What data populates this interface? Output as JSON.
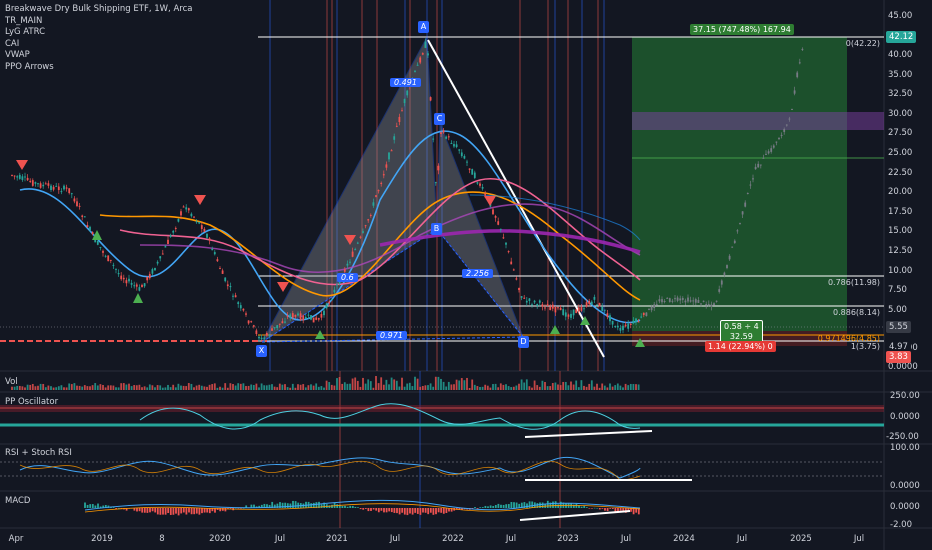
{
  "legend": {
    "title": "Breakwave Dry Bulk Shipping ETF, 1W, Arca",
    "indicators": [
      "TR_MAIN",
      "LyG ATRC",
      "CAI",
      "VWAP",
      "PPO Arrows"
    ]
  },
  "panes": {
    "vol": "Vol",
    "ppo": "PP Oscillator",
    "rsi": "RSI + Stoch RSI",
    "macd": "MACD"
  },
  "price_axis": [
    "45.00",
    "40.00",
    "35.00",
    "32.50",
    "30.00",
    "27.50",
    "25.00",
    "22.50",
    "20.00",
    "17.50",
    "15.00",
    "12.50",
    "10.00",
    "7.50",
    "5.00",
    "2.50",
    "0.0000"
  ],
  "price_labels": {
    "last_high": "42.12",
    "current": "5.55",
    "low_green": "4.97",
    "low_red": "3.83"
  },
  "ppo_axis": [
    "250.00",
    "0.0000",
    "-250.00"
  ],
  "rsi_axis": [
    "100.00",
    "0.0000"
  ],
  "macd_axis": [
    "0.0000",
    "-2.00"
  ],
  "time_axis": [
    "Apr",
    "2019",
    "8",
    "2020",
    "Jul",
    "2021",
    "Jul",
    "2022",
    "Jul",
    "2023",
    "Jul",
    "2024",
    "Jul",
    "2025",
    "Jul"
  ],
  "pattern": {
    "points": [
      "X",
      "A",
      "B",
      "C",
      "D"
    ],
    "ratios": [
      "0.491",
      "0.6",
      "2.256",
      "0.971"
    ]
  },
  "fib_levels": [
    "0(42.22)",
    "0.786(11.98)",
    "0.886(8.14)",
    "0.971496(4.85)",
    "1(3.75)"
  ],
  "trade_box": {
    "top_label": "37.15 (747.48%) 167.94",
    "middle_label_1": "0.58 ÷ 4",
    "middle_label_2": "32.59",
    "bottom_label": "1.14 (22.94%) 0"
  },
  "colors": {
    "background": "#131722",
    "pattern_fill": "#9598a1",
    "pattern_point": "#2962ff",
    "profit": "#1e5b2e",
    "loss": "#4b1d22",
    "up_candle": "#26a69a",
    "down_candle": "#ef5350"
  }
}
